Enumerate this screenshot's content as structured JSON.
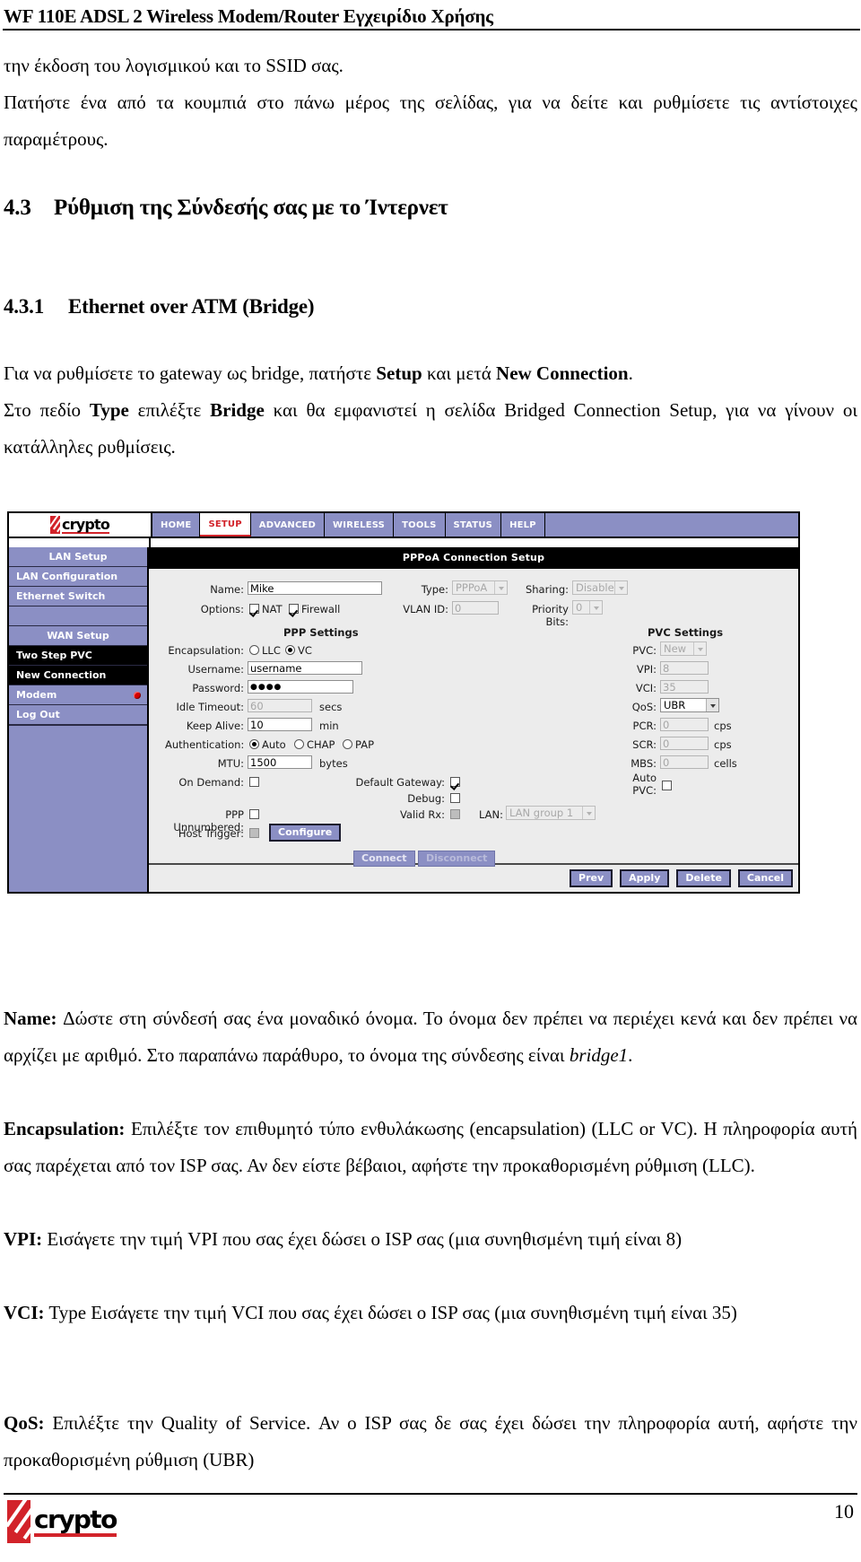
{
  "header": {
    "title": "WF 110E ADSL 2 Wireless Modem/Router Εγχειρίδιο Χρήσης"
  },
  "intro": {
    "line1": "την έκδοση του λογισμικού και το SSID σας.",
    "line2": "Πατήστε ένα από τα κουμπιά στο πάνω μέρος της σελίδας, για να δείτε και ρυθμίσετε τις αντίστοιχες παραμέτρους."
  },
  "section": {
    "number": "4.3",
    "title": "Ρύθμιση της Σύνδεσής σας με το Ίντερνετ"
  },
  "subsection": {
    "number": "4.3.1",
    "title": "Ethernet over ATM (Bridge)"
  },
  "paragraphs": {
    "p1_a": "Για να ρυθμίσετε το gateway ως bridge, πατήστε ",
    "p1_b1": "Setup",
    "p1_c": " και μετά ",
    "p1_b2": "New Connection",
    "p1_d": ".",
    "p2_a": "Στο πεδίο ",
    "p2_b1": "Type",
    "p2_c": " επιλέξτε ",
    "p2_b2": "Bridge",
    "p2_d": " και θα εμφανιστεί η σελίδα Bridged Connection Setup, για να γίνουν οι κατάλληλες ρυθμίσεις."
  },
  "notes": {
    "name_label": "Name:",
    "name_text_a": " Δώστε στη σύνδεσή σας ένα μοναδικό όνομα. Το όνομα δεν πρέπει να περιέχει κενά και δεν πρέπει να αρχίζει με αριθμό. Στο παραπάνω παράθυρο, το όνομα της σύνδεσης είναι ",
    "name_italic": "bridge1",
    "name_text_b": ".",
    "encap_label": "Encapsulation:",
    "encap_text": " Επιλέξτε τον επιθυμητό τύπο ενθυλάκωσης (encapsulation) (LLC or VC). Η πληροφορία αυτή σας παρέχεται από τον ISP σας. Αν δεν είστε βέβαιοι, αφήστε την προκαθορισμένη ρύθμιση (LLC).",
    "vpi_label": "VPI:",
    "vpi_text": " Εισάγετε την τιμή VPI που σας έχει δώσει ο ISP σας (μια συνηθισμένη τιμή είναι 8)",
    "vci_label": "VCI:",
    "vci_text": " Type Εισάγετε την τιμή VCI που σας έχει δώσει ο ISP σας (μια συνηθισμένη τιμή είναι 35)",
    "qos_label": "QoS:",
    "qos_text": " Επιλέξτε την Quality of Service. Αν ο ISP σας δε σας έχει δώσει την πληροφορία αυτή, αφήστε την προκαθορισμένη ρύθμιση (UBR)"
  },
  "router_ui": {
    "brand": "crypto",
    "nav": [
      {
        "label": "HOME",
        "active": false
      },
      {
        "label": "SETUP",
        "active": true
      },
      {
        "label": "ADVANCED",
        "active": false
      },
      {
        "label": "WIRELESS",
        "active": false
      },
      {
        "label": "TOOLS",
        "active": false
      },
      {
        "label": "STATUS",
        "active": false
      },
      {
        "label": "HELP",
        "active": false
      }
    ],
    "sidebar": [
      {
        "label": "LAN Setup",
        "type": "header"
      },
      {
        "label": "LAN Configuration",
        "type": "item"
      },
      {
        "label": "Ethernet Switch",
        "type": "item"
      },
      {
        "label": "",
        "type": "blank"
      },
      {
        "label": "WAN Setup",
        "type": "header"
      },
      {
        "label": "Two Step PVC",
        "type": "selected"
      },
      {
        "label": "New Connection",
        "type": "selected"
      },
      {
        "label": "Modem",
        "type": "item",
        "led": true
      },
      {
        "label": "Log Out",
        "type": "item"
      }
    ],
    "panel_title": "PPPoA Connection Setup",
    "fields": {
      "name_label": "Name:",
      "name_value": "Mike",
      "type_label": "Type:",
      "type_value": "PPPoA",
      "sharing_label": "Sharing:",
      "sharing_value": "Disable",
      "options_label": "Options:",
      "nat_label": "NAT",
      "firewall_label": "Firewall",
      "vlan_label": "VLAN ID:",
      "vlan_value": "0",
      "priority_label": "Priority Bits:",
      "priority_value": "0",
      "ppp_settings_title": "PPP Settings",
      "encapsulation_label": "Encapsulation:",
      "encap_llc": "LLC",
      "encap_vc": "VC",
      "username_label": "Username:",
      "username_value": "username",
      "password_label": "Password:",
      "password_value": "●●●●",
      "idle_label": "Idle Timeout:",
      "idle_value": "60",
      "idle_unit": "secs",
      "keepalive_label": "Keep Alive:",
      "keepalive_value": "10",
      "keepalive_unit": "min",
      "auth_label": "Authentication:",
      "auth_auto": "Auto",
      "auth_chap": "CHAP",
      "auth_pap": "PAP",
      "mtu_label": "MTU:",
      "mtu_value": "1500",
      "mtu_unit": "bytes",
      "ondemand_label": "On Demand:",
      "pppunnum_label": "PPP Unnumbered:",
      "hosttrigger_label": "Host Trigger:",
      "configure_button": "Configure",
      "defgw_label": "Default Gateway:",
      "debug_label": "Debug:",
      "validrx_label": "Valid Rx:",
      "lan_label": "LAN:",
      "lan_value": "LAN group 1",
      "pvc_settings_title": "PVC Settings",
      "pvc_label": "PVC:",
      "pvc_value": "New",
      "vpi_label": "VPI:",
      "vpi_value": "8",
      "vci_label": "VCI:",
      "vci_value": "35",
      "qos_label": "QoS:",
      "qos_value": "UBR",
      "pcr_label": "PCR:",
      "pcr_value": "0",
      "pcr_unit": "cps",
      "scr_label": "SCR:",
      "scr_value": "0",
      "scr_unit": "cps",
      "mbs_label": "MBS:",
      "mbs_value": "0",
      "mbs_unit": "cells",
      "autopvc_label_1": "Auto",
      "autopvc_label_2": "PVC:"
    },
    "buttons": {
      "connect": "Connect",
      "disconnect": "Disconnect",
      "prev": "Prev",
      "apply": "Apply",
      "delete": "Delete",
      "cancel": "Cancel"
    }
  },
  "footer": {
    "brand": "crypto",
    "page_number": "10"
  },
  "colors": {
    "brand_red": "#d2232a",
    "ui_purple": "#8b8fc4",
    "panel_bg": "#ececec"
  }
}
